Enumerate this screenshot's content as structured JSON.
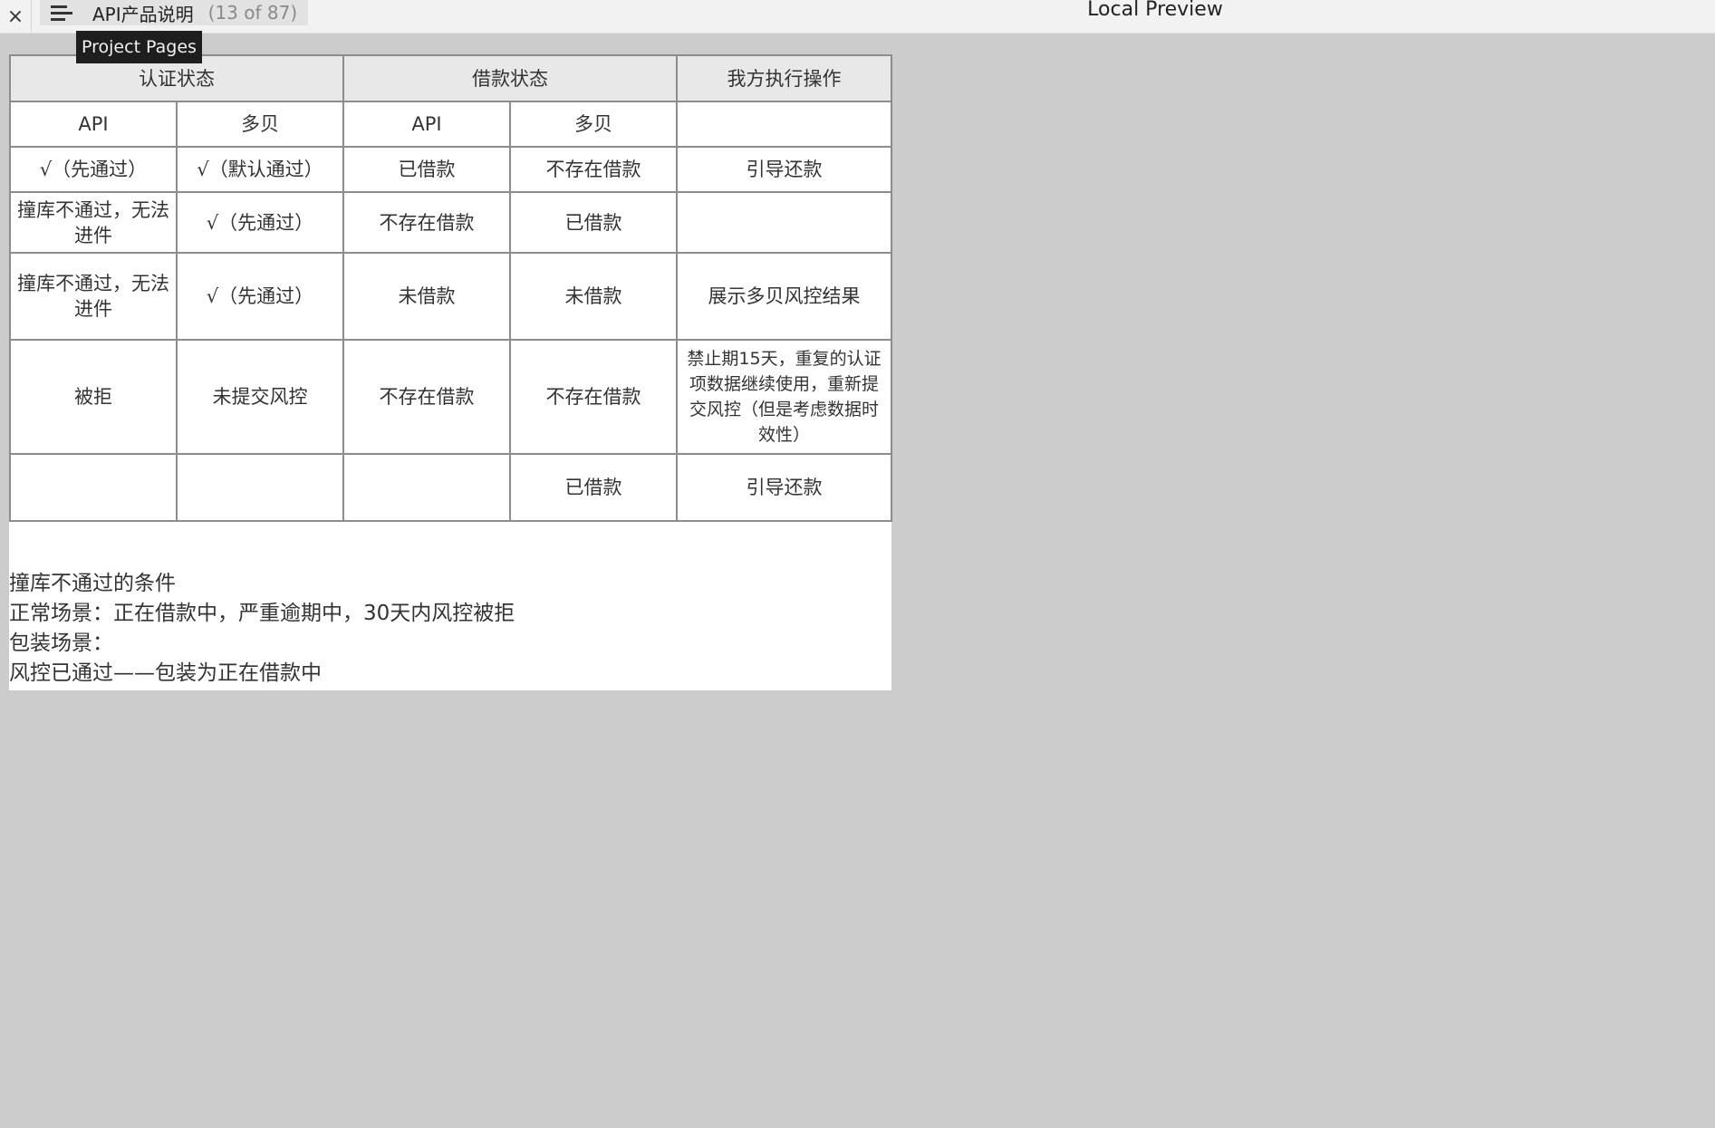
{
  "toolbar": {
    "close_label": "×",
    "tab_title": "API产品说明",
    "tab_count": "(13 of 87)",
    "preview_label": "Local Preview",
    "tooltip": "Project Pages"
  },
  "table": {
    "header_groups": [
      "认证状态",
      "借款状态",
      "我方执行操作"
    ],
    "sub_headers": [
      "API",
      "多贝",
      "API",
      "多贝",
      ""
    ],
    "rows": [
      [
        "√（先通过）",
        "√（默认通过）",
        "已借款",
        "不存在借款",
        "引导还款"
      ],
      [
        "撞库不通过，无法进件",
        "√（先通过）",
        "不存在借款",
        "已借款",
        ""
      ],
      [
        "撞库不通过，无法进件",
        "√（先通过）",
        "未借款",
        "未借款",
        "展示多贝风控结果"
      ],
      [
        "被拒",
        "未提交风控",
        "不存在借款",
        "不存在借款",
        "禁止期15天，重复的认证项数据继续使用，重新提交风控（但是考虑数据时效性）"
      ],
      [
        "",
        "",
        "",
        "已借款",
        "引导还款"
      ]
    ]
  },
  "notes": [
    "撞库不通过的条件",
    "正常场景：正在借款中，严重逾期中，30天内风控被拒",
    "包装场景：",
    "风控已通过——包装为正在借款中"
  ]
}
